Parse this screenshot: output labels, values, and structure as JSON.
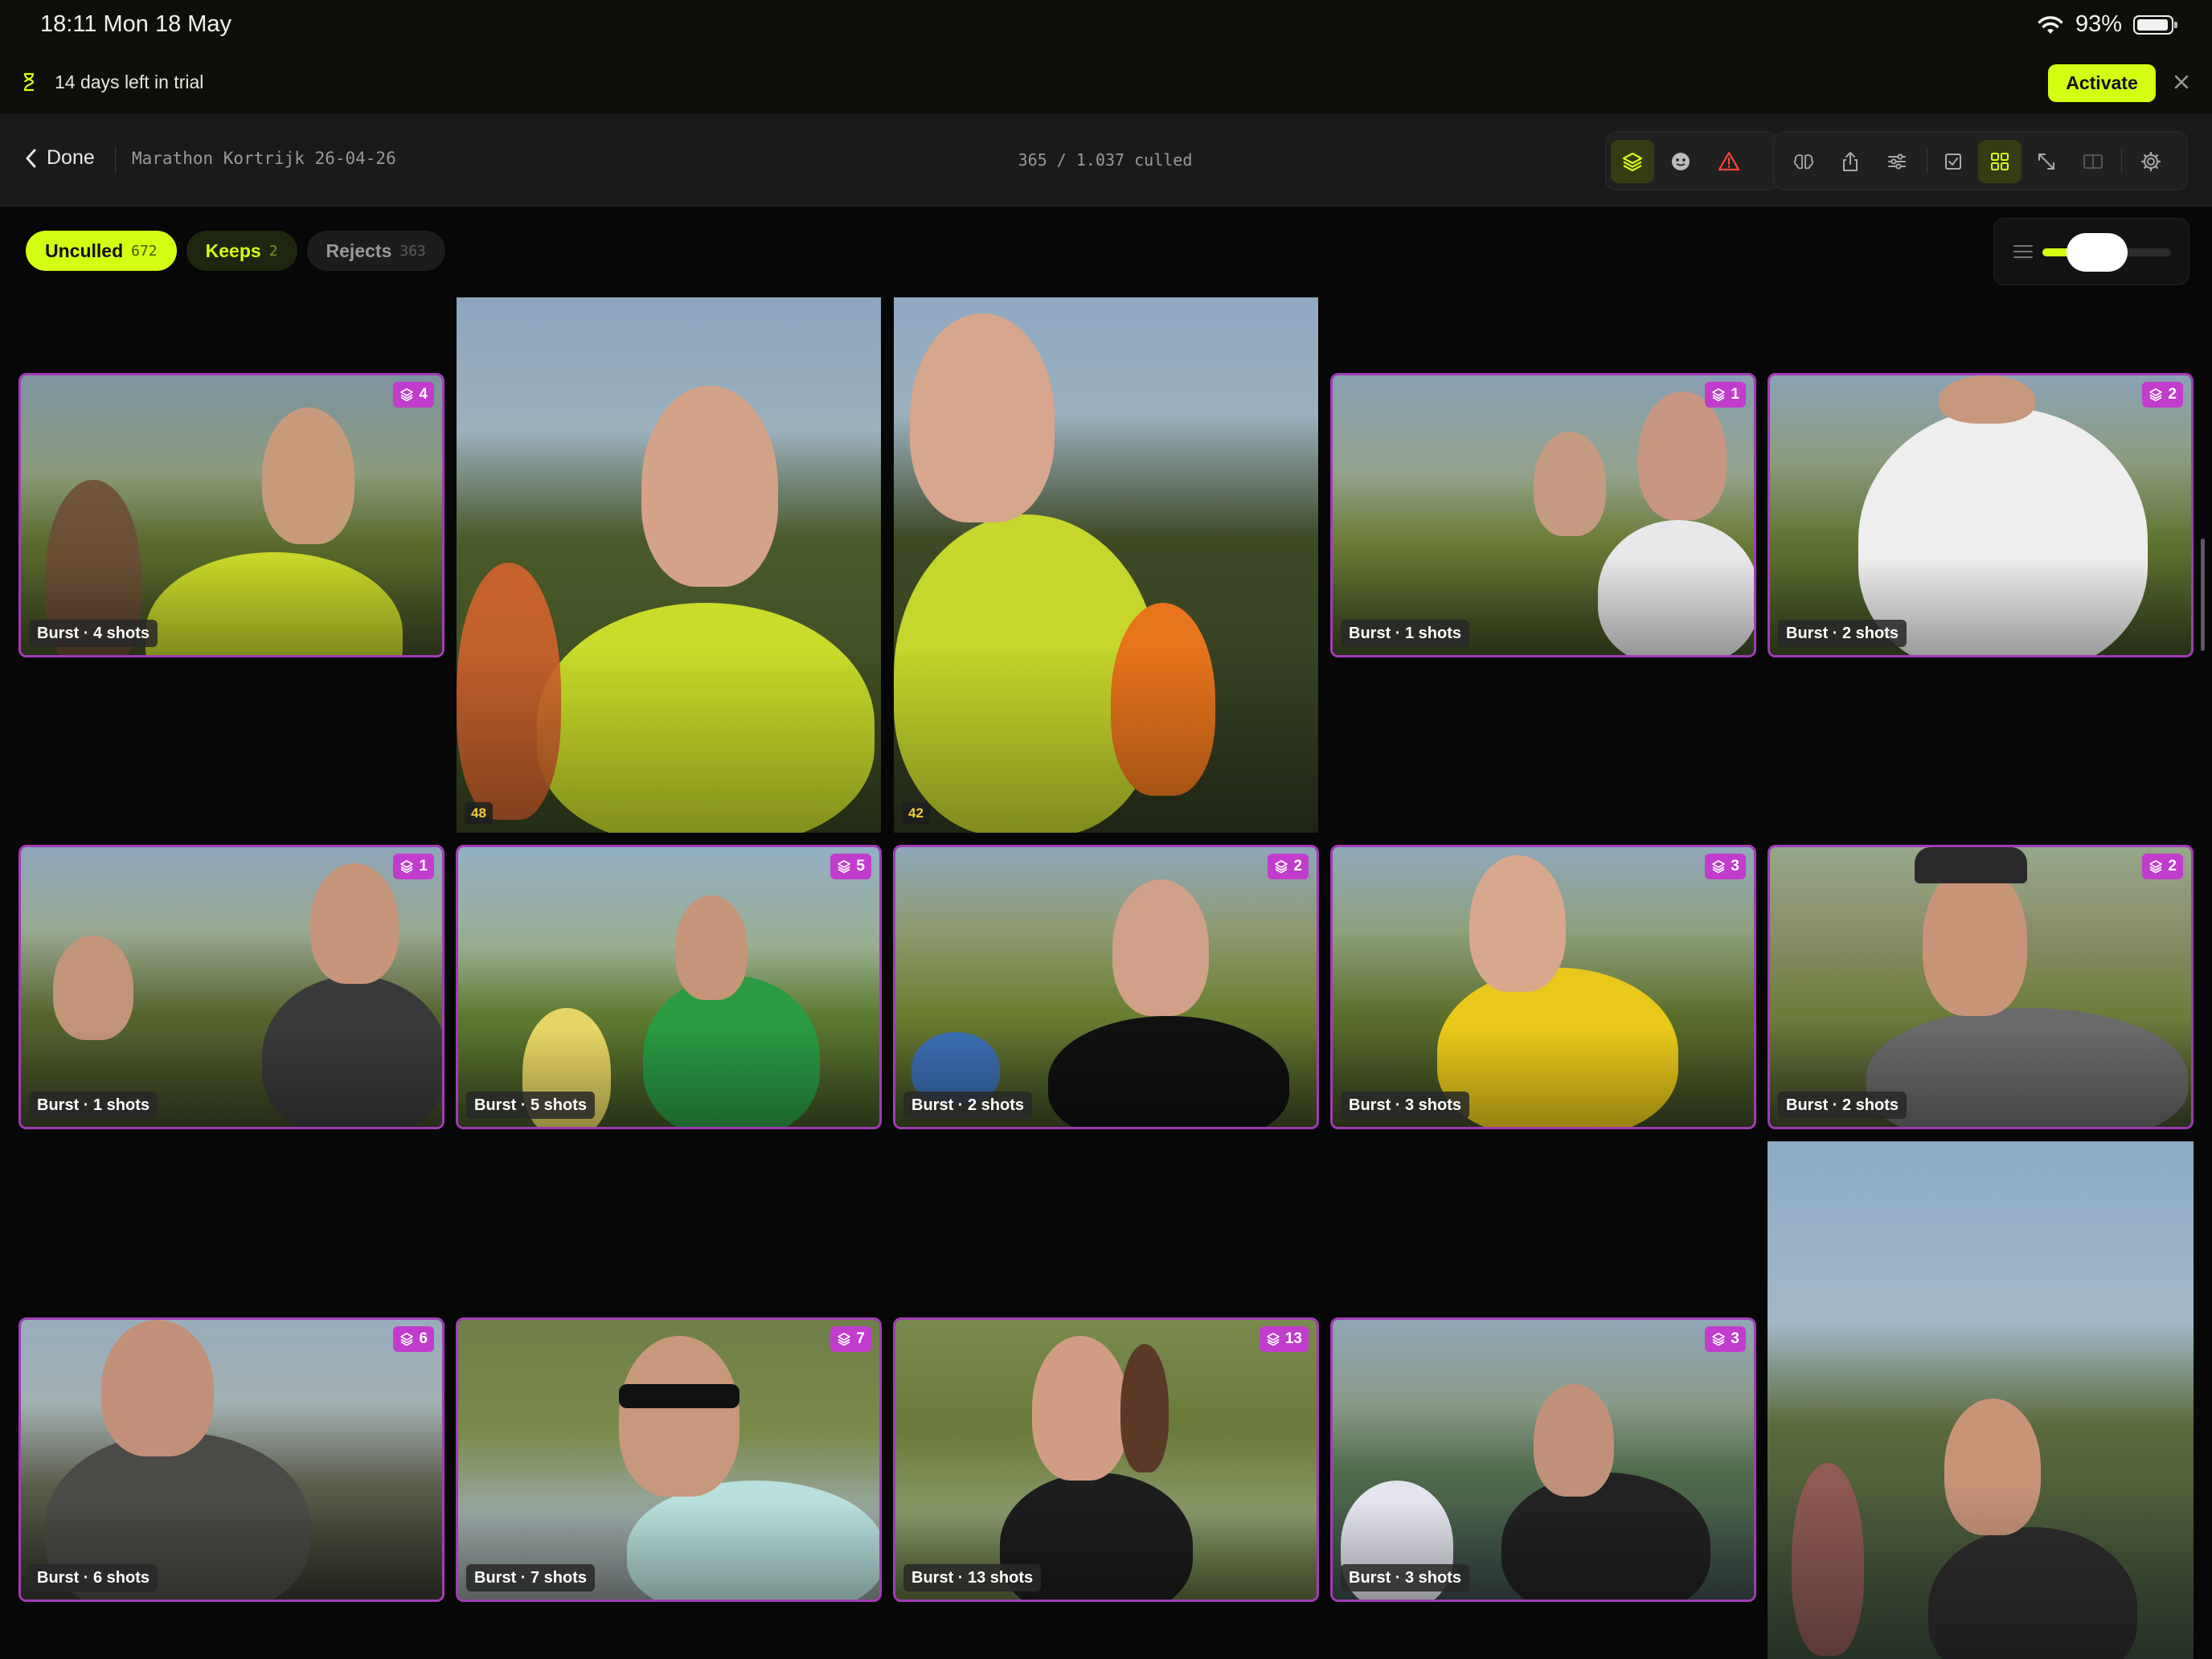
{
  "status_bar": {
    "time": "18:11  Mon 18 May",
    "battery": "93%"
  },
  "trial_banner": {
    "message": "14 days left in trial",
    "activate_label": "Activate"
  },
  "toolbar": {
    "back_label": "Done",
    "album_title": "Marathon Kortrijk 26-04-26",
    "culled_count": "365 / 1.037 culled"
  },
  "filters": [
    {
      "label": "Unculled",
      "count": "672",
      "active": true
    },
    {
      "label": "Keeps",
      "count": "2"
    },
    {
      "label": "Rejects",
      "count": "363"
    }
  ],
  "photos": [
    {
      "label": "Burst · 4 shots",
      "stack": "4",
      "sky": "#7d94a2",
      "ground": "#5a6a2c",
      "shirt": "#c7d629"
    },
    {
      "number": "48",
      "sky": "#8ba6bf",
      "ground": "#4a5a2a",
      "shirt": "#c9dc2a"
    },
    {
      "number": "42",
      "sky": "#8fa9c2",
      "ground": "#3e4a26",
      "shirt": "#c5d62c"
    },
    {
      "label": "Burst · 1 shots",
      "stack": "1",
      "sky": "#87a0b3",
      "ground": "#6a7a34",
      "shirt": "#e8e8ea"
    },
    {
      "label": "Burst · 2 shots",
      "stack": "2",
      "sky": "#8aa2b5",
      "ground": "#5e7230",
      "shirt": "#eeeeee"
    },
    {
      "label": "Burst · 1 shots",
      "stack": "1",
      "sky": "#8ea6bb",
      "ground": "#56642e",
      "shirt": "#3a3a3a"
    },
    {
      "label": "Burst · 5 shots",
      "stack": "5",
      "sky": "#93afc4",
      "ground": "#5e7a30",
      "shirt": "#2a9a44"
    },
    {
      "label": "Burst · 2 shots",
      "stack": "2",
      "sky": "#8da7b9",
      "ground": "#6a7d30",
      "shirt": "#111111"
    },
    {
      "label": "Burst · 3 shots",
      "stack": "3",
      "sky": "#8fa8bb",
      "ground": "#5c6e2c",
      "shirt": "#e8c81a"
    },
    {
      "label": "Burst · 2 shots",
      "stack": "2",
      "sky": "#96a88a",
      "ground": "#6c7c3a",
      "shirt": "#6a6a6a"
    },
    {
      "label": "Burst · 6 shots",
      "stack": "6",
      "sky": "#98adbd",
      "ground": "#5a5a48",
      "shirt": "#4a4a46"
    },
    {
      "label": "Burst · 7 shots",
      "stack": "7",
      "sky": "#6f7e4a",
      "ground": "#7a8a4a",
      "shirt": "#b8e0dc"
    },
    {
      "label": "Burst · 13 shots",
      "stack": "13",
      "sky": "#7a8a4e",
      "ground": "#6a7a3a",
      "shirt": "#1d1d1d"
    },
    {
      "label": "Burst · 3 shots",
      "stack": "3",
      "sky": "#8fa6b6",
      "ground": "#4e6a4a",
      "shirt": "#222222"
    },
    {
      "sky": "#8dabc6",
      "ground": "#5a6a3a",
      "shirt": "#2d2d2d"
    }
  ],
  "colors": {
    "accent": "#d4ff12",
    "burst_border": "#a23bb8",
    "stack_badge": "#c13ccc",
    "warning": "#ff453a"
  }
}
